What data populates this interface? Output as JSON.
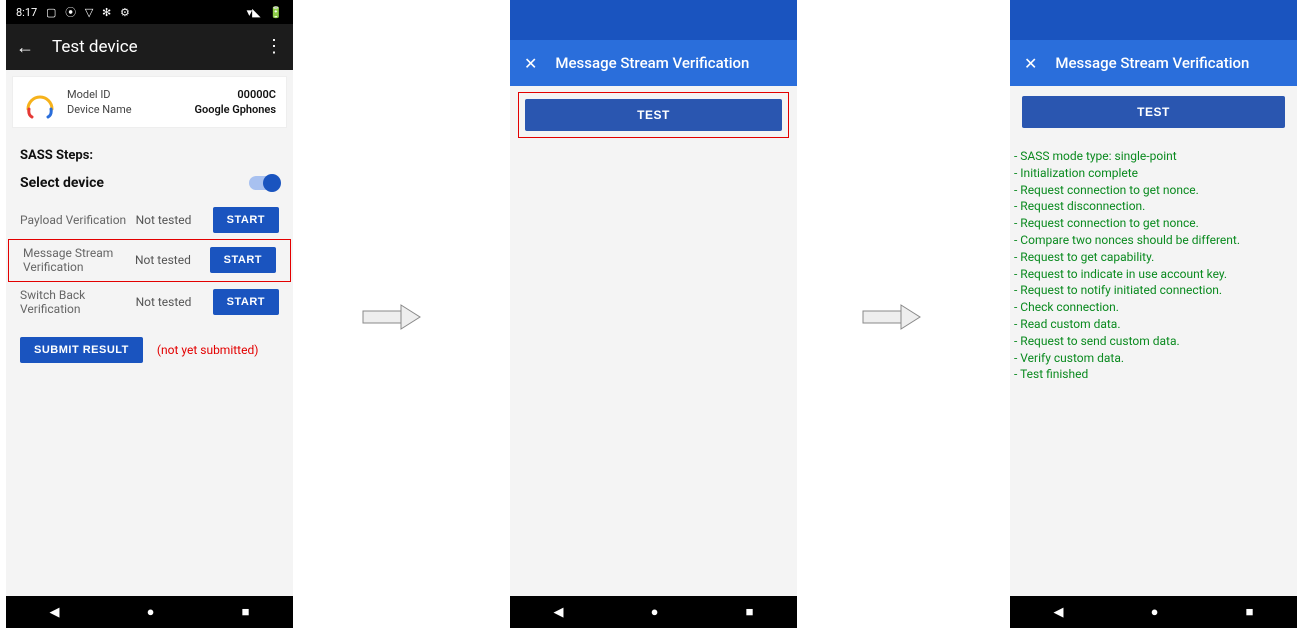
{
  "phone1": {
    "status": {
      "time": "8:17",
      "left_icons": [
        "▢",
        "⦿",
        "▽",
        "✻",
        "⚙"
      ],
      "right_icons": [
        "▾◣",
        "🔋"
      ]
    },
    "appbar": {
      "title": "Test device"
    },
    "card": {
      "model_label": "Model ID",
      "model_value": "00000C",
      "device_label": "Device Name",
      "device_value": "Google Gphones"
    },
    "sass_label": "SASS Steps:",
    "select_label": "Select device",
    "steps": [
      {
        "name": "Payload Verification",
        "status": "Not tested",
        "btn": "START"
      },
      {
        "name": "Message Stream Verification",
        "status": "Not tested",
        "btn": "START"
      },
      {
        "name": "Switch Back Verification",
        "status": "Not tested",
        "btn": "START"
      }
    ],
    "submit_label": "SUBMIT RESULT",
    "submit_note": "(not yet submitted)"
  },
  "phone2": {
    "title": "Message Stream Verification",
    "test_btn": "TEST"
  },
  "phone3": {
    "title": "Message Stream Verification",
    "test_btn": "TEST",
    "log": [
      "SASS mode type: single-point",
      "Initialization complete",
      "Request connection to get nonce.",
      "Request disconnection.",
      "Request connection to get nonce.",
      "Compare two nonces should be different.",
      "Request to get capability.",
      "Request to indicate in use account key.",
      "Request to notify initiated connection.",
      "Check connection.",
      "Read custom data.",
      "Request to send custom data.",
      "Verify custom data.",
      "Test finished"
    ]
  },
  "nav_glyphs": {
    "back": "◀",
    "home": "●",
    "recent": "■"
  }
}
